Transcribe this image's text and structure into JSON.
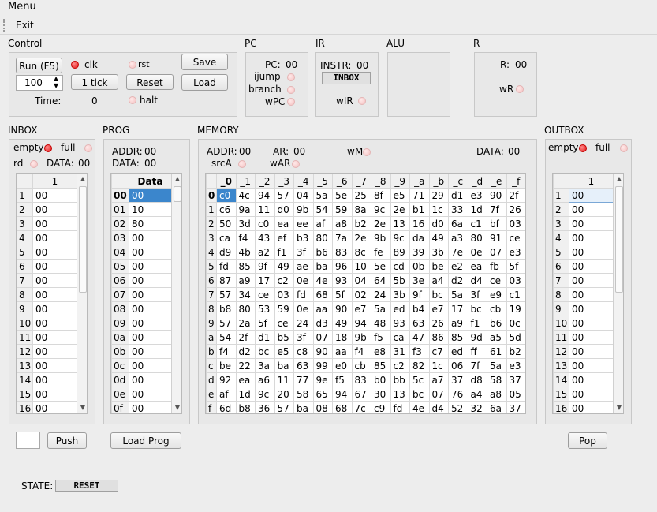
{
  "menubar": {
    "menu_label": "Menu"
  },
  "toolbar": {
    "exit_label": "Exit"
  },
  "control": {
    "title": "Control",
    "run_label": "Run (F5)",
    "clk_label": "clk",
    "rst_label": "rst",
    "speed_value": "100",
    "tick_label": "1 tick",
    "reset_label": "Reset",
    "save_label": "Save",
    "load_label": "Load",
    "time_label": "Time:",
    "time_value": "0",
    "halt_label": "halt"
  },
  "pc": {
    "title": "PC",
    "pc_label": "PC:",
    "pc_value": "00",
    "ijump_label": "ijump",
    "branch_label": "branch",
    "wpc_label": "wPC"
  },
  "ir": {
    "title": "IR",
    "instr_label": "INSTR:",
    "instr_value": "00",
    "instr_name": "INBOX",
    "wir_label": "wIR"
  },
  "alu": {
    "title": "ALU"
  },
  "r": {
    "title": "R",
    "r_label": "R:",
    "r_value": "00",
    "wr_label": "wR"
  },
  "inbox": {
    "title": "INBOX",
    "empty_label": "empty",
    "full_label": "full",
    "rd_label": "rd",
    "data_label": "DATA:",
    "data_value": "00",
    "col_header": "1",
    "rows": [
      "1",
      "2",
      "3",
      "4",
      "5",
      "6",
      "7",
      "8",
      "9",
      "10",
      "11",
      "12",
      "13",
      "14",
      "15",
      "16"
    ],
    "values": [
      "00",
      "00",
      "00",
      "00",
      "00",
      "00",
      "00",
      "00",
      "00",
      "00",
      "00",
      "00",
      "00",
      "00",
      "00",
      "00"
    ],
    "push_label": "Push"
  },
  "prog": {
    "title": "PROG",
    "addr_label": "ADDR:",
    "addr_value": "00",
    "data_label": "DATA:",
    "data_value": "00",
    "col_header": "Data",
    "rows": [
      "00",
      "01",
      "02",
      "03",
      "04",
      "05",
      "06",
      "07",
      "08",
      "09",
      "0a",
      "0b",
      "0c",
      "0d",
      "0e",
      "0f"
    ],
    "values": [
      "00",
      "10",
      "80",
      "00",
      "00",
      "00",
      "00",
      "00",
      "00",
      "00",
      "00",
      "00",
      "00",
      "00",
      "00",
      "00"
    ],
    "load_prog_label": "Load Prog"
  },
  "memory": {
    "title": "MEMORY",
    "addr_label": "ADDR:",
    "addr_value": "00",
    "ar_label": "AR:",
    "ar_value": "00",
    "wm_label": "wM",
    "data_label": "DATA:",
    "data_value": "00",
    "srca_label": "srcA",
    "war_label": "wAR",
    "cols": [
      "_0",
      "_1",
      "_2",
      "_3",
      "_4",
      "_5",
      "_6",
      "_7",
      "_8",
      "_9",
      "_a",
      "_b",
      "_c",
      "_d",
      "_e",
      "_f"
    ],
    "rows": [
      "0",
      "1",
      "2",
      "3",
      "4",
      "5",
      "6",
      "7",
      "8",
      "9",
      "a",
      "b",
      "c",
      "d",
      "e",
      "f"
    ],
    "cells": [
      [
        "c0",
        "4c",
        "94",
        "57",
        "04",
        "5a",
        "5e",
        "25",
        "8f",
        "e5",
        "71",
        "29",
        "d1",
        "e3",
        "90",
        "2f"
      ],
      [
        "c6",
        "9a",
        "11",
        "d0",
        "9b",
        "54",
        "59",
        "8a",
        "9c",
        "2e",
        "b1",
        "1c",
        "33",
        "1d",
        "7f",
        "26"
      ],
      [
        "50",
        "3d",
        "c0",
        "ea",
        "ee",
        "af",
        "a8",
        "b2",
        "2e",
        "13",
        "16",
        "d0",
        "6a",
        "c1",
        "bf",
        "03"
      ],
      [
        "ca",
        "f4",
        "43",
        "ef",
        "b3",
        "80",
        "7a",
        "2e",
        "9b",
        "9c",
        "da",
        "49",
        "a3",
        "80",
        "91",
        "ce"
      ],
      [
        "d9",
        "4b",
        "a2",
        "f1",
        "3f",
        "b6",
        "83",
        "8c",
        "fe",
        "89",
        "39",
        "3b",
        "7e",
        "0e",
        "07",
        "e3"
      ],
      [
        "fd",
        "85",
        "9f",
        "49",
        "ae",
        "ba",
        "96",
        "10",
        "5e",
        "cd",
        "0b",
        "be",
        "e2",
        "ea",
        "fb",
        "5f"
      ],
      [
        "87",
        "a9",
        "17",
        "c2",
        "0e",
        "4e",
        "93",
        "04",
        "64",
        "5b",
        "3e",
        "a4",
        "d2",
        "d4",
        "ce",
        "03"
      ],
      [
        "57",
        "34",
        "ce",
        "03",
        "fd",
        "68",
        "5f",
        "02",
        "24",
        "3b",
        "9f",
        "bc",
        "5a",
        "3f",
        "e9",
        "c1"
      ],
      [
        "b8",
        "80",
        "53",
        "59",
        "0e",
        "aa",
        "90",
        "e7",
        "5a",
        "ed",
        "b4",
        "e7",
        "17",
        "bc",
        "cb",
        "19"
      ],
      [
        "57",
        "2a",
        "5f",
        "ce",
        "24",
        "d3",
        "49",
        "94",
        "48",
        "93",
        "63",
        "26",
        "a9",
        "f1",
        "b6",
        "0c"
      ],
      [
        "54",
        "2f",
        "d1",
        "b5",
        "3f",
        "07",
        "18",
        "9b",
        "f5",
        "ca",
        "47",
        "86",
        "85",
        "9d",
        "a5",
        "5d"
      ],
      [
        "f4",
        "d2",
        "bc",
        "e5",
        "c8",
        "90",
        "aa",
        "f4",
        "e8",
        "31",
        "f3",
        "c7",
        "ed",
        "ff",
        "61",
        "b2"
      ],
      [
        "be",
        "22",
        "3a",
        "ba",
        "63",
        "99",
        "e0",
        "cb",
        "85",
        "c2",
        "82",
        "1c",
        "06",
        "7f",
        "5a",
        "e3"
      ],
      [
        "92",
        "ea",
        "a6",
        "11",
        "77",
        "9e",
        "f5",
        "83",
        "b0",
        "bb",
        "5c",
        "a7",
        "37",
        "d8",
        "58",
        "37"
      ],
      [
        "af",
        "1d",
        "9c",
        "20",
        "58",
        "65",
        "94",
        "67",
        "30",
        "13",
        "bc",
        "07",
        "76",
        "a4",
        "a8",
        "05"
      ],
      [
        "6d",
        "b8",
        "36",
        "57",
        "ba",
        "08",
        "68",
        "7c",
        "c9",
        "fd",
        "4e",
        "d4",
        "52",
        "32",
        "6a",
        "37"
      ]
    ]
  },
  "outbox": {
    "title": "OUTBOX",
    "empty_label": "empty",
    "full_label": "full",
    "col_header": "1",
    "rows": [
      "1",
      "2",
      "3",
      "4",
      "5",
      "6",
      "7",
      "8",
      "9",
      "10",
      "11",
      "12",
      "13",
      "14",
      "15",
      "16"
    ],
    "values": [
      "00",
      "00",
      "00",
      "00",
      "00",
      "00",
      "00",
      "00",
      "00",
      "00",
      "00",
      "00",
      "00",
      "00",
      "00",
      "00"
    ],
    "pop_label": "Pop"
  },
  "state": {
    "label": "STATE:",
    "value": "RESET"
  }
}
